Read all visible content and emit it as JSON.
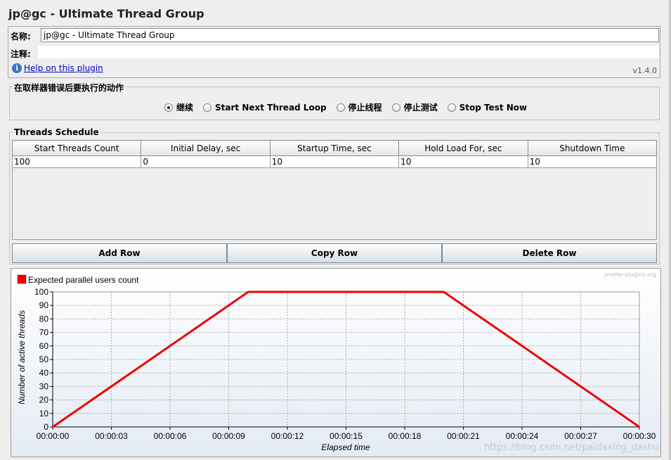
{
  "window": {
    "title": "jp@gc - Ultimate Thread Group"
  },
  "name_panel": {
    "name_label": "名称:",
    "name_value": "jp@gc - Ultimate Thread Group",
    "comment_label": "注释:",
    "comment_value": "",
    "help_link": "Help on this plugin",
    "version": "v1.4.0"
  },
  "error_action": {
    "title": "在取样器错误后要执行的动作",
    "options": [
      {
        "label": "继续",
        "selected": true
      },
      {
        "label": "Start Next Thread Loop",
        "selected": false
      },
      {
        "label": "停止线程",
        "selected": false
      },
      {
        "label": "停止测试",
        "selected": false
      },
      {
        "label": "Stop Test Now",
        "selected": false
      }
    ]
  },
  "schedule": {
    "title": "Threads Schedule",
    "columns": [
      "Start Threads Count",
      "Initial Delay, sec",
      "Startup Time, sec",
      "Hold Load For, sec",
      "Shutdown Time"
    ],
    "rows": [
      [
        "100",
        "0",
        "10",
        "10",
        "10"
      ]
    ]
  },
  "buttons": {
    "add": "Add Row",
    "copy": "Copy Row",
    "delete": "Delete Row"
  },
  "chart": {
    "watermark": "jmeter-plugins.org",
    "credit": "https://blog.csdn.net/paidaxing_dashu"
  },
  "chart_data": {
    "type": "line",
    "title": "",
    "xlabel": "Elapsed time",
    "ylabel": "Number of active threads",
    "ylim": [
      0,
      100
    ],
    "xlim": [
      0,
      30
    ],
    "grid": true,
    "legend": "top-left",
    "xticks": [
      "00:00:00",
      "00:00:03",
      "00:00:06",
      "00:00:09",
      "00:00:12",
      "00:00:15",
      "00:00:18",
      "00:00:21",
      "00:00:24",
      "00:00:27",
      "00:00:30"
    ],
    "yticks": [
      0,
      10,
      20,
      30,
      40,
      50,
      60,
      70,
      80,
      90,
      100
    ],
    "series": [
      {
        "name": "Expected parallel users count",
        "color": "#ee0000",
        "x": [
          0,
          10,
          20,
          30
        ],
        "y": [
          0,
          100,
          100,
          0
        ]
      }
    ]
  }
}
